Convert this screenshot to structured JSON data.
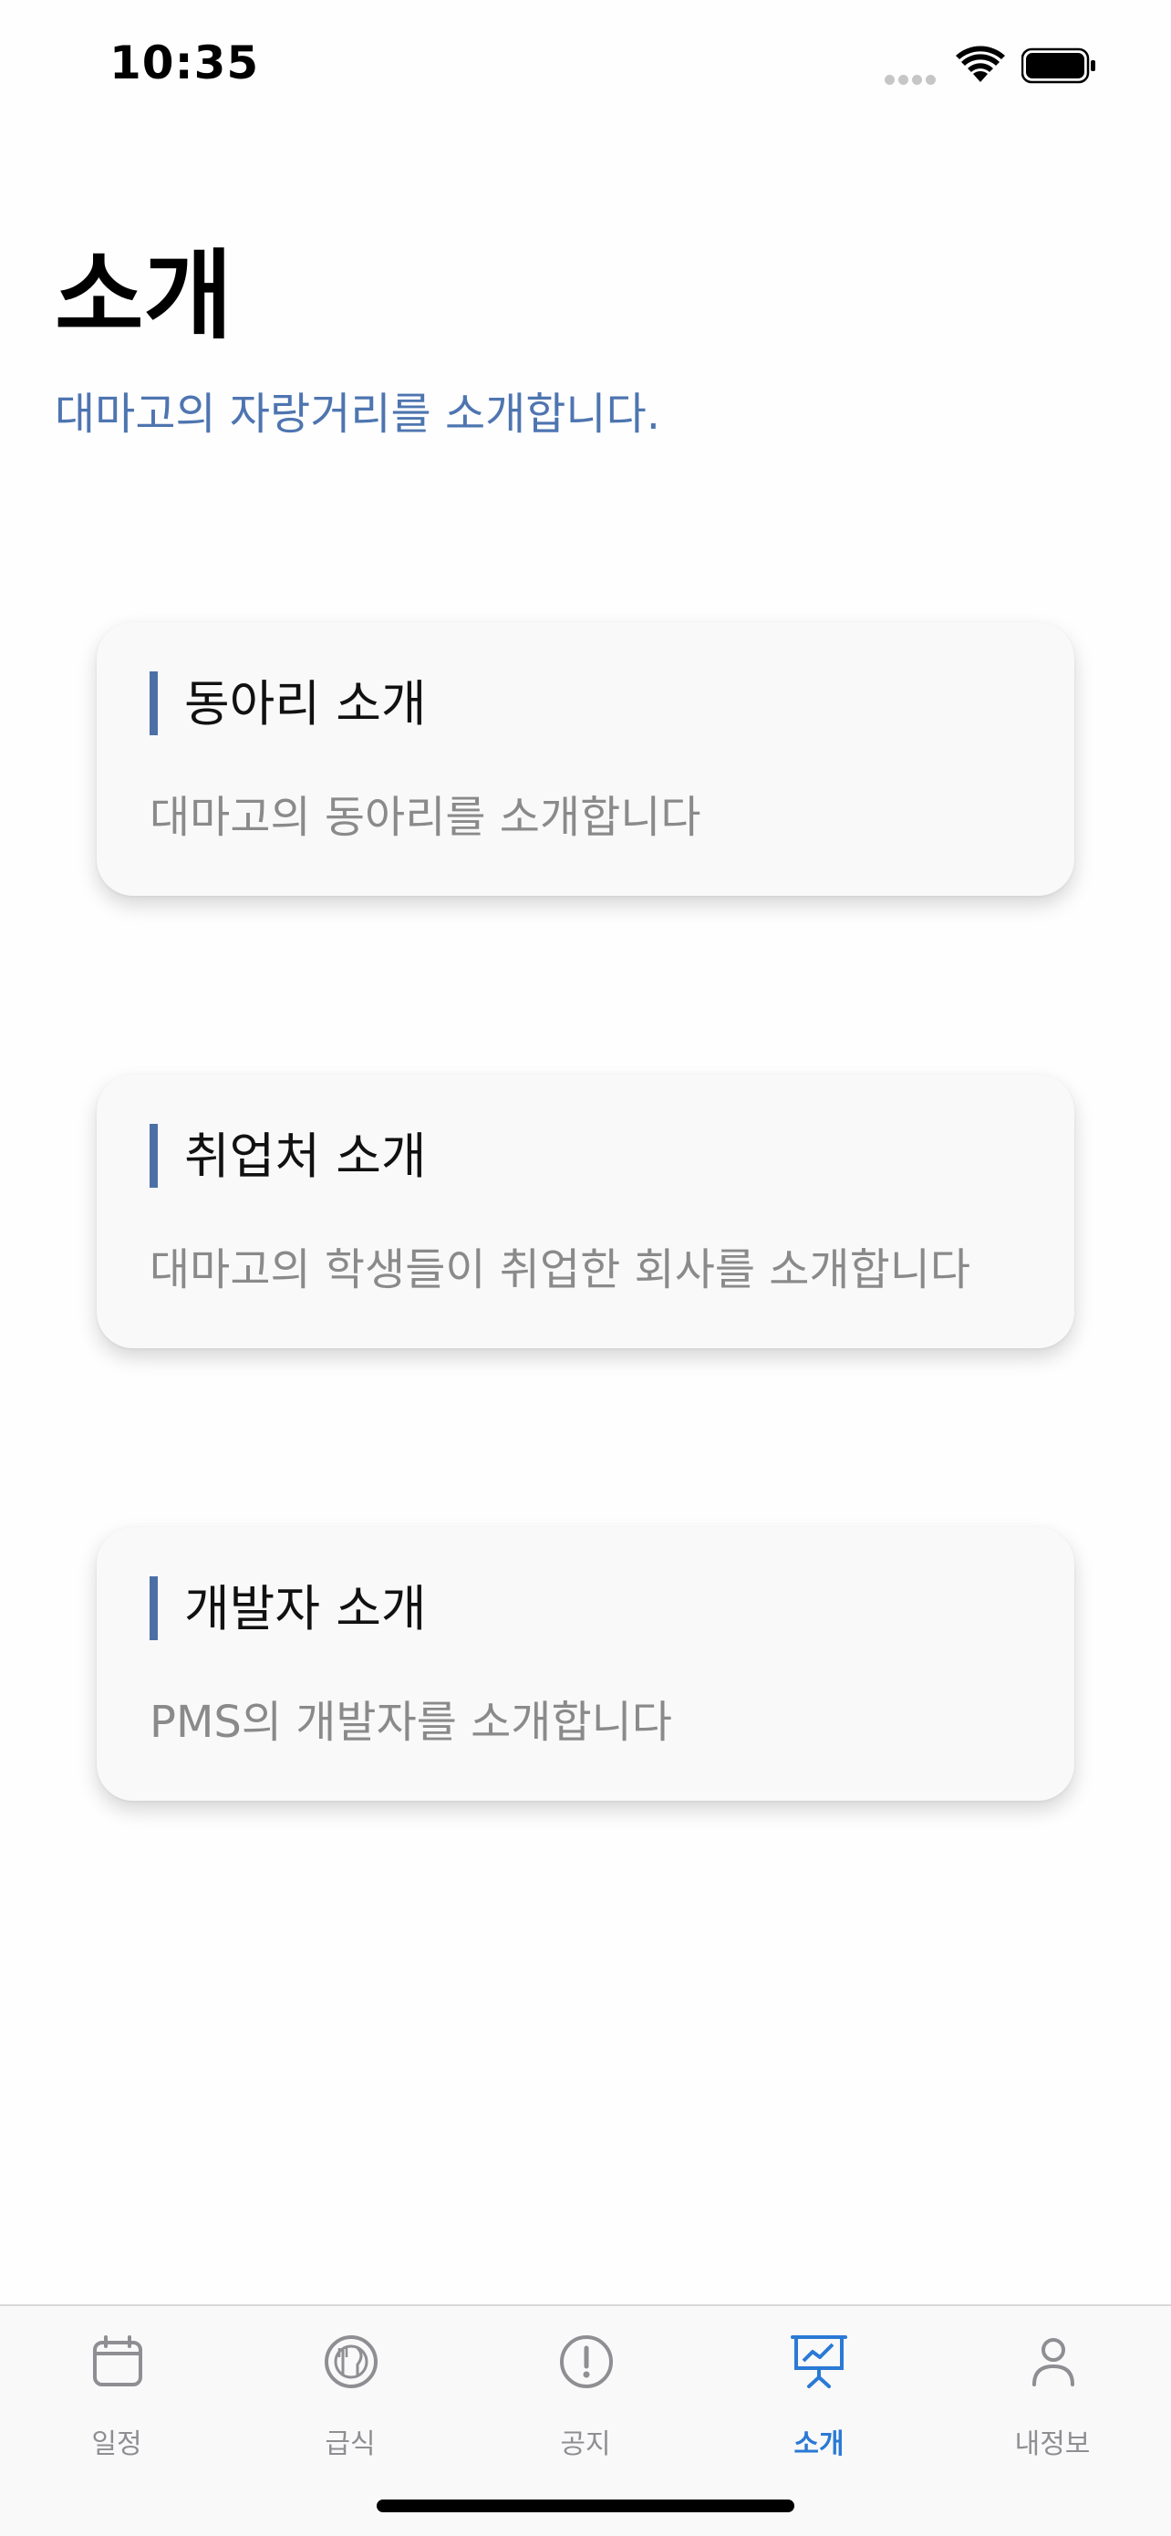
{
  "status_bar": {
    "time": "10:35"
  },
  "header": {
    "title": "소개",
    "subtitle": "대마고의 자랑거리를 소개합니다."
  },
  "cards": [
    {
      "title": "동아리 소개",
      "description": "대마고의 동아리를 소개합니다"
    },
    {
      "title": "취업처 소개",
      "description": "대마고의 학생들이 취업한 회사를 소개합니다"
    },
    {
      "title": "개발자 소개",
      "description": "PMS의 개발자를 소개합니다"
    }
  ],
  "tab_bar": {
    "tabs": [
      {
        "label": "일정",
        "icon": "calendar-icon",
        "active": false
      },
      {
        "label": "급식",
        "icon": "meal-icon",
        "active": false
      },
      {
        "label": "공지",
        "icon": "notice-icon",
        "active": false
      },
      {
        "label": "소개",
        "icon": "presentation-icon",
        "active": true
      },
      {
        "label": "내정보",
        "icon": "person-icon",
        "active": false
      }
    ]
  },
  "colors": {
    "accent": "#4c6fa6",
    "subtitle": "#4e75b0",
    "tab_active": "#2a7ad5",
    "tab_inactive": "#8e8e93"
  }
}
